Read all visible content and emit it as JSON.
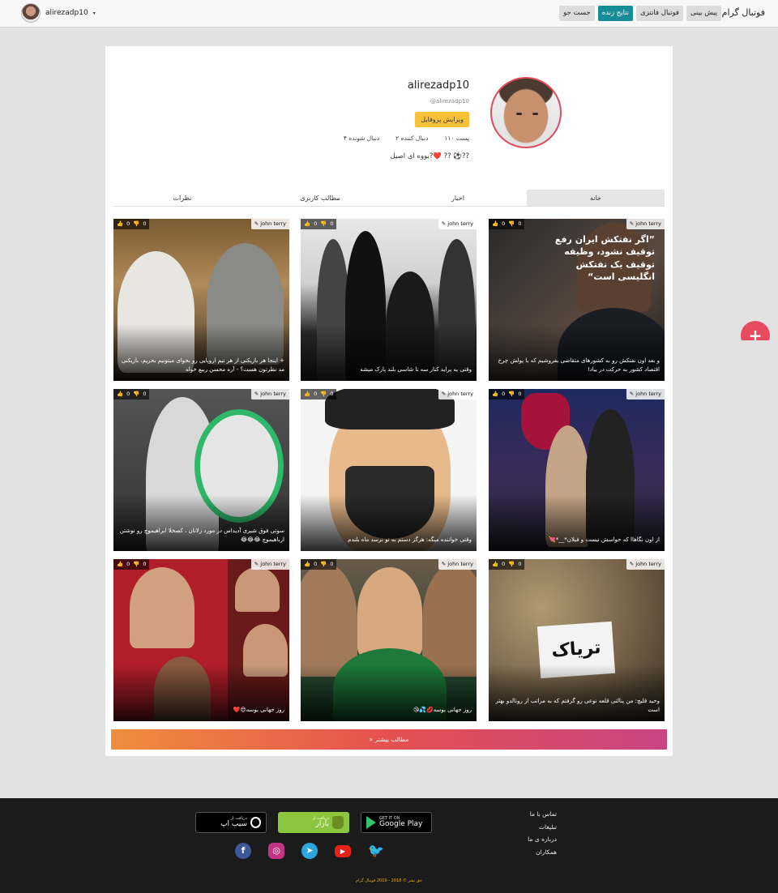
{
  "navbar": {
    "brand": "فوتبال گرام",
    "buttons": [
      "پیش بینی",
      "فوتبال فانتزی",
      "نتایج زنده",
      "جست جو"
    ],
    "active_button": "نتایج زنده",
    "user": {
      "name": "alirezadp10",
      "caret": "▾"
    }
  },
  "profile": {
    "username": "alirezadp10",
    "handle": "@alirezadp10",
    "edit_label": "ویرایش پروفایل",
    "stats": [
      "۱۱۰ پست",
      "۲ دنبال کننده",
      "۴ دنبال شونده"
    ],
    "bio": "یووه ای اصیل?❤️ ?? ⚽️??"
  },
  "tabs": [
    "خانه",
    "اخبار",
    "مطالب کاربری",
    "نظرات"
  ],
  "posts": [
    {
      "author": "john terry",
      "likes": "0",
      "dislikes": "0",
      "caption": "و بعد اون نفتکش رو به کشورهای متقاضی بفروشیم که با پولش چرخ اقتصاد کشور به حرکت در بیاد!",
      "overlay": "”اگر نفتکش ایران رفع توقیف نشود، وظیفه توقیف یک نفتکش انگلیسی است“"
    },
    {
      "author": "john terry",
      "likes": "0",
      "dislikes": "0",
      "caption": "وقتی یه پراید کنار سه تا شاسی بلند پارک میشه"
    },
    {
      "author": "john terry",
      "likes": "0",
      "dislikes": "0",
      "caption": "+ اینجا هر بازیکنی از هر تیم اروپایی رو بخوای میتونیم بخریم، بازیکنی مد نظرتون هست؟ - آره محسن ربیع خواه"
    },
    {
      "author": "john terry",
      "likes": "0",
      "dislikes": "0",
      "caption": "از اون نگاهاا که حواسش نیست و فیلان*__*💘"
    },
    {
      "author": "john terry",
      "likes": "0",
      "dislikes": "0",
      "caption": "وقتی خواننده میگه: هرگز دستم به تو نرسد ماه بلندم"
    },
    {
      "author": "john terry",
      "likes": "0",
      "dislikes": "0",
      "caption": "سوتی فوق شیری آدیداس در مورد زلاتان ، کصخلا ابراهیموچ رو نوشتن ارباهیموچ 😂😂😂"
    },
    {
      "author": "john terry",
      "likes": "0",
      "dislikes": "0",
      "caption": "وحید قلیچ: من پنالتی قلعه نوعی رو گرفتم که به مراتب از رونالدو بهتر است",
      "sign": "تریاک"
    },
    {
      "author": "john terry",
      "likes": "0",
      "dislikes": "0",
      "caption": "روز جهانی بوسه💋💦😘"
    },
    {
      "author": "john terry",
      "likes": "0",
      "dislikes": "0",
      "caption": "روز جهانی بوسه😍❤️"
    }
  ],
  "more_label": "»  مطالب بیشتر",
  "fab_label": "+",
  "footer": {
    "links": [
      "تماس با ما",
      "تبلیغات",
      "درباره ی ما",
      "همکاران"
    ],
    "stores": {
      "google_play": {
        "small": "GET IT ON",
        "large": "Google Play"
      },
      "bazaar": {
        "small": "دریافت از",
        "large": "بازار"
      },
      "sibapp": {
        "small": "دریافت از",
        "large": "سیب اپ"
      }
    },
    "socials": [
      "facebook",
      "instagram",
      "telegram",
      "youtube",
      "twitter"
    ],
    "copyright": "حق نشر © 2018 - 2019 فوتبال گرام"
  }
}
